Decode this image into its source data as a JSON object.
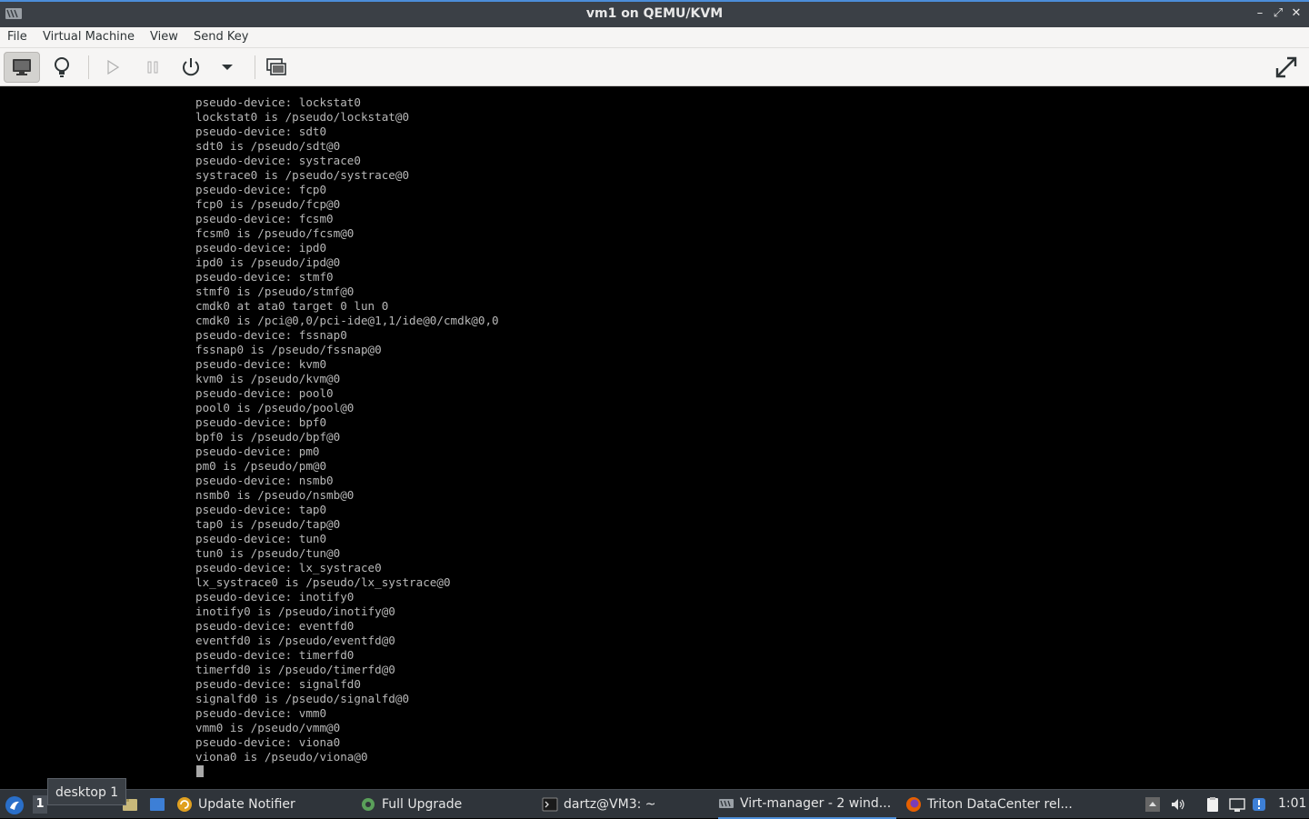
{
  "window": {
    "title": "vm1 on QEMU/KVM",
    "minimize_glyph": "–",
    "maximize_glyph": "⤢",
    "close_glyph": "✕"
  },
  "menu": {
    "items": [
      "File",
      "Virtual Machine",
      "View",
      "Send Key"
    ]
  },
  "toolbar": {
    "buttons": [
      "console-view",
      "details-view",
      "run",
      "pause",
      "shutdown",
      "shutdown-menu",
      "screenshot",
      "fullscreen"
    ]
  },
  "console": {
    "lines": [
      "pseudo-device: lockstat0",
      "lockstat0 is /pseudo/lockstat@0",
      "pseudo-device: sdt0",
      "sdt0 is /pseudo/sdt@0",
      "pseudo-device: systrace0",
      "systrace0 is /pseudo/systrace@0",
      "pseudo-device: fcp0",
      "fcp0 is /pseudo/fcp@0",
      "pseudo-device: fcsm0",
      "fcsm0 is /pseudo/fcsm@0",
      "pseudo-device: ipd0",
      "ipd0 is /pseudo/ipd@0",
      "pseudo-device: stmf0",
      "stmf0 is /pseudo/stmf@0",
      "cmdk0 at ata0 target 0 lun 0",
      "cmdk0 is /pci@0,0/pci-ide@1,1/ide@0/cmdk@0,0",
      "pseudo-device: fssnap0",
      "fssnap0 is /pseudo/fssnap@0",
      "pseudo-device: kvm0",
      "kvm0 is /pseudo/kvm@0",
      "pseudo-device: pool0",
      "pool0 is /pseudo/pool@0",
      "pseudo-device: bpf0",
      "bpf0 is /pseudo/bpf@0",
      "pseudo-device: pm0",
      "pm0 is /pseudo/pm@0",
      "pseudo-device: nsmb0",
      "nsmb0 is /pseudo/nsmb@0",
      "pseudo-device: tap0",
      "tap0 is /pseudo/tap@0",
      "pseudo-device: tun0",
      "tun0 is /pseudo/tun@0",
      "pseudo-device: lx_systrace0",
      "lx_systrace0 is /pseudo/lx_systrace@0",
      "pseudo-device: inotify0",
      "inotify0 is /pseudo/inotify@0",
      "pseudo-device: eventfd0",
      "eventfd0 is /pseudo/eventfd@0",
      "pseudo-device: timerfd0",
      "timerfd0 is /pseudo/timerfd@0",
      "pseudo-device: signalfd0",
      "signalfd0 is /pseudo/signalfd@0",
      "pseudo-device: vmm0",
      "vmm0 is /pseudo/vmm@0",
      "pseudo-device: viona0",
      "viona0 is /pseudo/viona@0"
    ]
  },
  "taskbar": {
    "workspace_active": "1",
    "workspace_tooltip": "desktop 1",
    "tasks": [
      {
        "label": "Update Notifier",
        "icon": "update-notifier-icon"
      },
      {
        "label": "Full Upgrade",
        "icon": "gear-icon"
      },
      {
        "label": "dartz@VM3: ~",
        "icon": "terminal-icon"
      },
      {
        "label": "Virt-manager - 2 wind...",
        "icon": "virt-manager-icon"
      },
      {
        "label": "Triton DataCenter rel...",
        "icon": "firefox-icon"
      }
    ],
    "clock": "1:01"
  },
  "colors": {
    "accent": "#4c8ed9",
    "titlebar": "#3b4046",
    "taskbar": "#2f343a",
    "console_bg": "#000000",
    "console_text": "#b8b8b8"
  }
}
